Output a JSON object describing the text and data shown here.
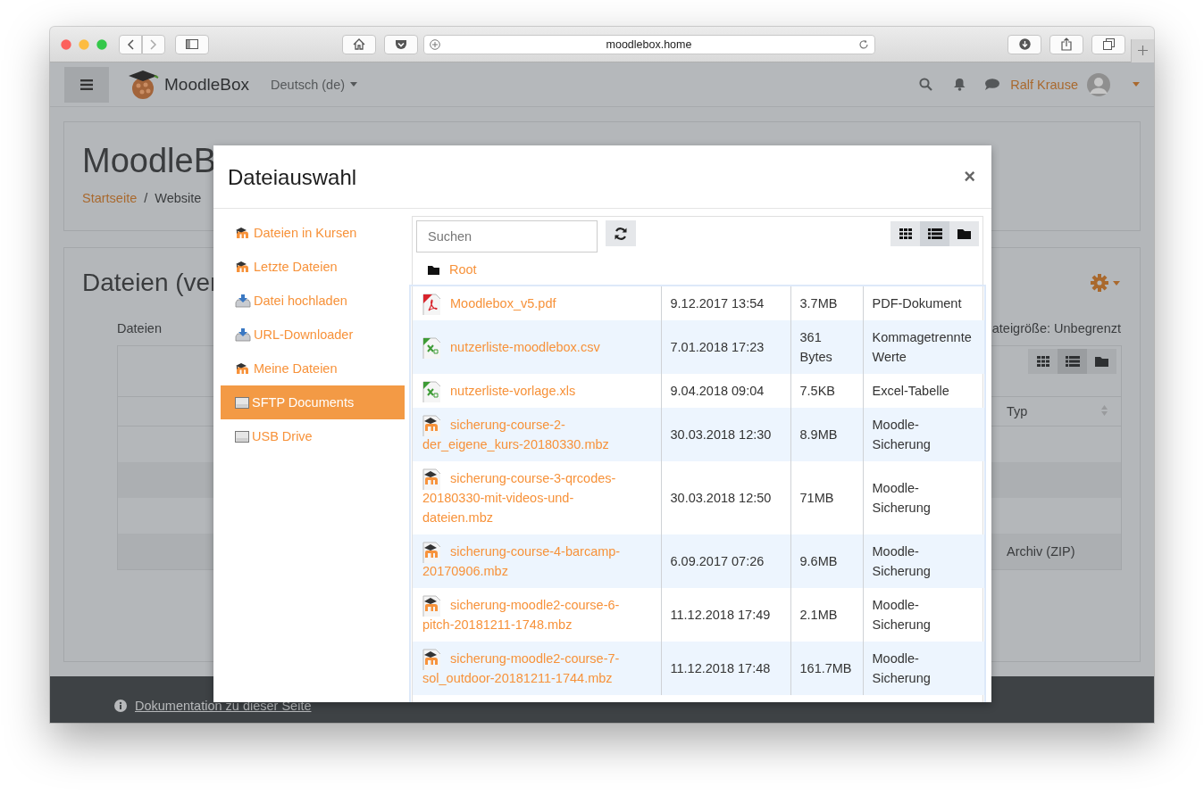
{
  "browser": {
    "url": "moodlebox.home"
  },
  "navbar": {
    "brand": "MoodleBox",
    "language": "Deutsch (de)",
    "user": "Ralf Krause"
  },
  "page_header": {
    "title": "MoodleB",
    "breadcrumb": [
      {
        "label": "Startseite",
        "link": true
      },
      {
        "label": "Website",
        "link": false
      }
    ],
    "separator": "/"
  },
  "section": {
    "title": "Dateien (ver",
    "field_label": "Dateien",
    "max_size": "ateigröße: Unbegrenzt",
    "views": [
      {
        "kind": "grid",
        "selected": false
      },
      {
        "kind": "list",
        "selected": true
      },
      {
        "kind": "tree",
        "selected": false
      }
    ],
    "table": {
      "column_header": "Typ",
      "last_row_type": "Archiv (ZIP)"
    }
  },
  "footer": {
    "link": "Dokumentation zu dieser Seite"
  },
  "dialog": {
    "title": "Dateiauswahl",
    "close": "×",
    "repositories": [
      {
        "label": "Dateien in Kursen",
        "kind": "moodle",
        "selected": false
      },
      {
        "label": "Letzte Dateien",
        "kind": "moodle",
        "selected": false
      },
      {
        "label": "Datei hochladen",
        "kind": "upload",
        "selected": false
      },
      {
        "label": "URL-Downloader",
        "kind": "upload",
        "selected": false
      },
      {
        "label": "Meine Dateien",
        "kind": "moodle",
        "selected": false
      },
      {
        "label": "SFTP Documents",
        "kind": "drive",
        "selected": true
      },
      {
        "label": "USB Drive",
        "kind": "drive",
        "selected": false
      }
    ],
    "search": {
      "placeholder": "Suchen"
    },
    "views": [
      {
        "kind": "grid",
        "selected": false
      },
      {
        "kind": "list",
        "selected": true
      },
      {
        "kind": "tree",
        "selected": false
      }
    ],
    "path": "Root",
    "files": [
      {
        "kind": "pdf",
        "name": "Moodlebox_v5.pdf",
        "date": "9.12.2017 13:54",
        "size": "3.7MB",
        "type": "PDF-Dokument"
      },
      {
        "kind": "sheet",
        "name": "nutzerliste-moodlebox.csv",
        "date": "7.01.2018 17:23",
        "size": "361 Bytes",
        "type": "Kommagetrennte Werte"
      },
      {
        "kind": "sheet",
        "name": "nutzerliste-vorlage.xls",
        "date": "9.04.2018 09:04",
        "size": "7.5KB",
        "type": "Excel-Tabelle"
      },
      {
        "kind": "backup",
        "name": "sicherung-course-2-der_eigene_kurs-20180330.mbz",
        "date": "30.03.2018 12:30",
        "size": "8.9MB",
        "type": "Moodle-Sicherung"
      },
      {
        "kind": "backup",
        "name": "sicherung-course-3-qrcodes-20180330-mit-videos-und-dateien.mbz",
        "date": "30.03.2018 12:50",
        "size": "71MB",
        "type": "Moodle-Sicherung"
      },
      {
        "kind": "backup",
        "name": "sicherung-course-4-barcamp-20170906.mbz",
        "date": "6.09.2017 07:26",
        "size": "9.6MB",
        "type": "Moodle-Sicherung"
      },
      {
        "kind": "backup",
        "name": "sicherung-moodle2-course-6-pitch-20181211-1748.mbz",
        "date": "11.12.2018 17:49",
        "size": "2.1MB",
        "type": "Moodle-Sicherung"
      },
      {
        "kind": "backup",
        "name": "sicherung-moodle2-course-7-sol_outdoor-20181211-1744.mbz",
        "date": "11.12.2018 17:48",
        "size": "161.7MB",
        "type": "Moodle-Sicherung"
      }
    ]
  }
}
